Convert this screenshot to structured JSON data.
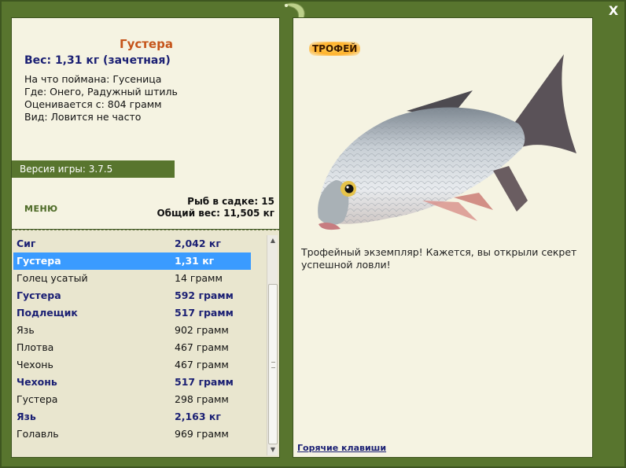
{
  "close_label": "X",
  "catch": {
    "name": "Густера",
    "weight_line": "Вес: 1,31 кг (зачетная)",
    "bait": "На что поймана: Гусеница",
    "place": "Где: Онего, Радужный штиль",
    "valued_from": "Оценивается с: 804 грамм",
    "kind": "Вид: Ловится не часто"
  },
  "version": "Версия игры: 3.7.5",
  "menu_label": "МЕНЮ",
  "keepnet": {
    "count_line": "Рыб в садке: 15",
    "total_line": "Общий вес: 11,505 кг"
  },
  "fish_list": [
    {
      "name": "Сиг",
      "weight": "2,042 кг",
      "trophy": true,
      "selected": false
    },
    {
      "name": "Густера",
      "weight": "1,31 кг",
      "trophy": true,
      "selected": true
    },
    {
      "name": "Голец усатый",
      "weight": "14 грамм",
      "trophy": false,
      "selected": false
    },
    {
      "name": "Густера",
      "weight": "592 грамм",
      "trophy": true,
      "selected": false
    },
    {
      "name": "Подлещик",
      "weight": "517 грамм",
      "trophy": true,
      "selected": false
    },
    {
      "name": "Язь",
      "weight": "902 грамм",
      "trophy": false,
      "selected": false
    },
    {
      "name": "Плотва",
      "weight": "467 грамм",
      "trophy": false,
      "selected": false
    },
    {
      "name": "Чехонь",
      "weight": "467 грамм",
      "trophy": false,
      "selected": false
    },
    {
      "name": "Чехонь",
      "weight": "517 грамм",
      "trophy": true,
      "selected": false
    },
    {
      "name": "Густера",
      "weight": "298 грамм",
      "trophy": false,
      "selected": false
    },
    {
      "name": "Язь",
      "weight": "2,163 кг",
      "trophy": true,
      "selected": false
    },
    {
      "name": "Голавль",
      "weight": "969 грамм",
      "trophy": false,
      "selected": false
    }
  ],
  "trophy_badge": "ТРОФЕЙ",
  "trophy_text": "Трофейный экземпляр! Кажется, вы открыли секрет успешной ловли!",
  "hotkeys_label": "Горячие клавиши",
  "colors": {
    "frame_green": "#58752e",
    "panel_bg": "#f5f3e2",
    "trophy_blue": "#1a1f73",
    "title_orange": "#c5541a",
    "selection_blue": "#3a9bff"
  }
}
